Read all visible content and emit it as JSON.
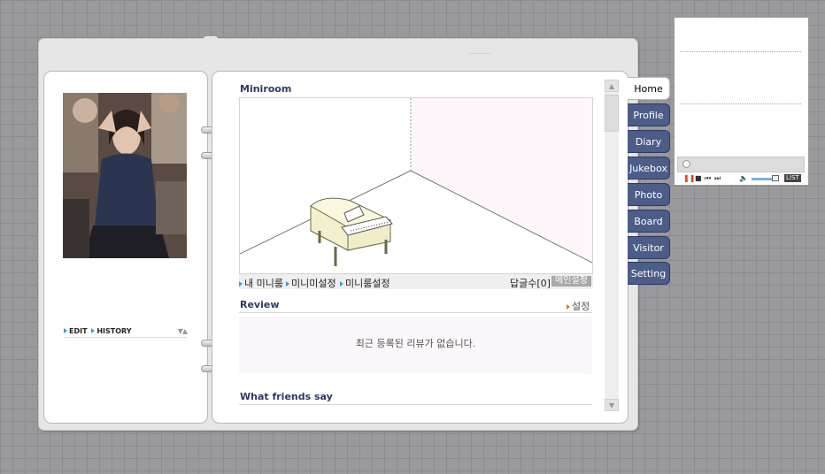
{
  "left_panel": {
    "profile_links": [
      "EDIT",
      "HISTORY"
    ],
    "sort_arrows": "▼▲"
  },
  "main": {
    "miniroom": {
      "title": "Miniroom",
      "links": [
        "내 미니룸",
        "미니미설정",
        "미니룸설정"
      ],
      "reply_count": "답글수[0]",
      "main_settings": "메인설정"
    },
    "review": {
      "title": "Review",
      "settings": "설정",
      "empty_message": "최근 등록된 리뷰가 없습니다."
    },
    "friends": {
      "title": "What friends say"
    }
  },
  "tabs": [
    {
      "label": "Home",
      "active": true
    },
    {
      "label": "Profile",
      "active": false
    },
    {
      "label": "Diary",
      "active": false
    },
    {
      "label": "Jukebox",
      "active": false
    },
    {
      "label": "Photo",
      "active": false
    },
    {
      "label": "Board",
      "active": false
    },
    {
      "label": "Visitor",
      "active": false
    },
    {
      "label": "Setting",
      "active": false
    }
  ],
  "player": {
    "list_label": "LIST",
    "accent_color": "#e0421e"
  },
  "colors": {
    "tab_bg": "#4c5d8a",
    "title": "#2b3a66",
    "background": "#9a9a9c"
  }
}
